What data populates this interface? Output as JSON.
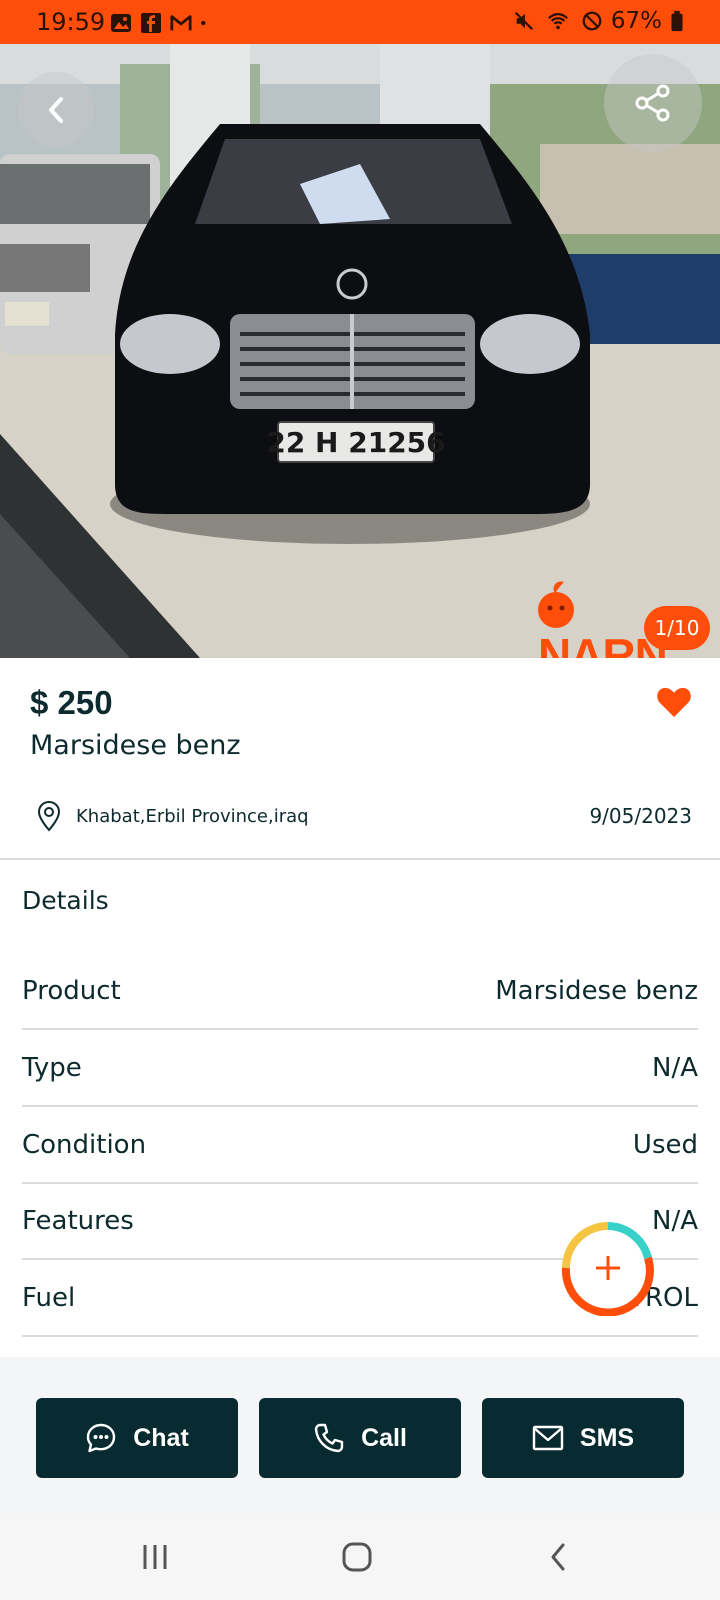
{
  "status_bar": {
    "time": "19:59",
    "battery": "67%",
    "left_icons": [
      "gallery-icon",
      "facebook-icon",
      "gmail-icon",
      "dot-icon"
    ],
    "right_icons": [
      "mute-icon",
      "wifi-icon",
      "dnd-icon",
      "battery-icon"
    ]
  },
  "gallery": {
    "counter": "1/10",
    "watermark": "NARN"
  },
  "listing": {
    "price": "$ 250",
    "title": "Marsidese benz",
    "location": "Khabat,Erbil Province,iraq",
    "date": "9/05/2023"
  },
  "details": {
    "heading": "Details",
    "rows": [
      {
        "key": "Product",
        "value": "Marsidese benz"
      },
      {
        "key": "Type",
        "value": "N/A"
      },
      {
        "key": "Condition",
        "value": "Used"
      },
      {
        "key": "Features",
        "value": "N/A"
      },
      {
        "key": "Fuel",
        "value": "PETROL"
      }
    ]
  },
  "actions": {
    "chat": "Chat",
    "call": "Call",
    "sms": "SMS"
  },
  "colors": {
    "accent": "#ff4d0a",
    "button_dark": "#082b31",
    "text": "#0d2b2e"
  }
}
